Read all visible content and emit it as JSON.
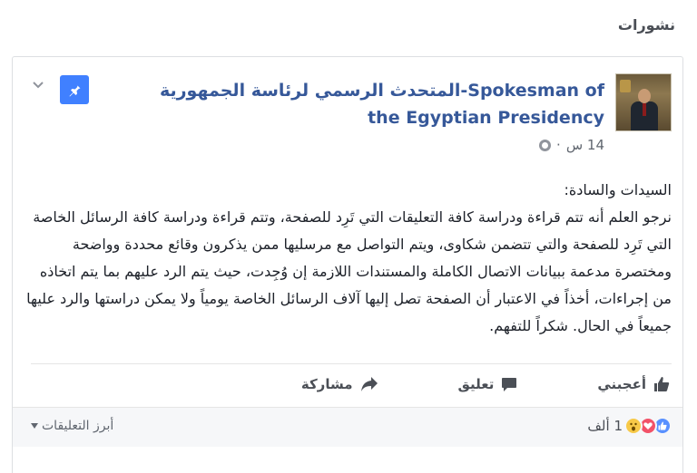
{
  "section": {
    "title": "نشورات"
  },
  "post": {
    "page_name": "المتحدث الرسمي لرئاسة الجمهورية-Spokesman of the Egyptian Presidency",
    "time": "14 س",
    "dot": "·",
    "paragraphs": [
      "السيدات والسادة:",
      "نرجو العلم أنه تتم قراءة ودراسة كافة التعليقات التي تَرِد للصفحة، وتتم قراءة ودراسة كافة الرسائل الخاصة التي تَرِد للصفحة والتي تتضمن شكاوى، ويتم التواصل مع مرسليها ممن يذكرون وقائع محددة وواضحة ومختصرة مدعمة ببيانات الاتصال الكاملة والمستندات اللازمة إن وُجِدت، حيث يتم الرد عليهم بما يتم اتخاذه من إجراءات، أخذاً في الاعتبار أن الصفحة تصل إليها آلاف الرسائل الخاصة يومياً ولا يمكن دراستها والرد عليها جميعاً في الحال. شكراً للتفهم."
    ]
  },
  "actions": {
    "like": "أعجبني",
    "comment": "تعليق",
    "share": "مشاركة"
  },
  "reactions": {
    "count": "1 ألف"
  },
  "comments_filter": {
    "label": "أبرز التعليقات"
  },
  "icons": {
    "pin": "pin-icon",
    "chevron": "chevron-down-icon",
    "globe": "globe-icon",
    "like": "thumbs-up-icon",
    "comment": "speech-bubble-icon",
    "share": "share-arrow-icon"
  },
  "colors": {
    "accent": "#4080ff",
    "link": "#365899",
    "love": "#f25268",
    "like_reaction": "#5890ff",
    "wow": "#f7c948"
  }
}
